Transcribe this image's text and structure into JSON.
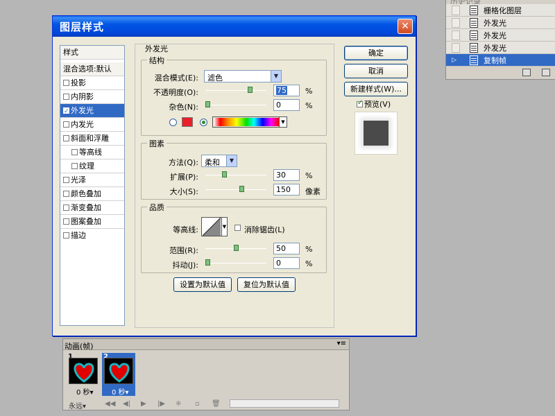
{
  "history": {
    "title": "历史记录",
    "items": [
      {
        "label": "栅格化图层",
        "selected": false
      },
      {
        "label": "外发光",
        "selected": false
      },
      {
        "label": "外发光",
        "selected": false
      },
      {
        "label": "外发光",
        "selected": false
      },
      {
        "label": "复制帧",
        "selected": true
      }
    ]
  },
  "dialog": {
    "title": "图层样式",
    "close_icon": "✕",
    "styles_list": {
      "header": "样式",
      "blend_options": "混合选项:默认",
      "items": [
        {
          "label": "投影",
          "checked": false,
          "indent": false,
          "selected": false
        },
        {
          "label": "内阴影",
          "checked": false,
          "indent": false,
          "selected": false
        },
        {
          "label": "外发光",
          "checked": true,
          "indent": false,
          "selected": true
        },
        {
          "label": "内发光",
          "checked": false,
          "indent": false,
          "selected": false
        },
        {
          "label": "斜面和浮雕",
          "checked": false,
          "indent": false,
          "selected": false
        },
        {
          "label": "等高线",
          "checked": false,
          "indent": true,
          "selected": false
        },
        {
          "label": "纹理",
          "checked": false,
          "indent": true,
          "selected": false
        },
        {
          "label": "光泽",
          "checked": false,
          "indent": false,
          "selected": false
        },
        {
          "label": "颜色叠加",
          "checked": false,
          "indent": false,
          "selected": false
        },
        {
          "label": "渐变叠加",
          "checked": false,
          "indent": false,
          "selected": false
        },
        {
          "label": "图案叠加",
          "checked": false,
          "indent": false,
          "selected": false
        },
        {
          "label": "描边",
          "checked": false,
          "indent": false,
          "selected": false
        }
      ]
    },
    "section_title": "外发光",
    "structure": {
      "caption": "结构",
      "blend_mode_label": "混合模式(E):",
      "blend_mode_value": "滤色",
      "opacity_label": "不透明度(O):",
      "opacity_value": "75",
      "opacity_fraction": 0.75,
      "noise_label": "杂色(N):",
      "noise_value": "0",
      "noise_fraction": 0.0,
      "percent": "%",
      "color_swatch": "#e8202a"
    },
    "elements": {
      "caption": "图素",
      "technique_label": "方法(Q):",
      "technique_value": "柔和",
      "spread_label": "扩展(P):",
      "spread_value": "30",
      "spread_fraction": 0.3,
      "size_label": "大小(S):",
      "size_value": "150",
      "size_fraction": 0.6,
      "size_unit": "像素",
      "percent": "%"
    },
    "quality": {
      "caption": "品质",
      "contour_label": "等高线:",
      "antialias_label": "消除锯齿(L)",
      "range_label": "范围(R):",
      "range_value": "50",
      "range_fraction": 0.5,
      "jitter_label": "抖动(J):",
      "jitter_value": "0",
      "jitter_fraction": 0.0,
      "percent": "%"
    },
    "make_default": "设置为默认值",
    "reset_default": "复位为默认值",
    "buttons": {
      "ok": "确定",
      "cancel": "取消",
      "new_style": "新建样式(W)...",
      "preview": "预览(V)"
    }
  },
  "animation": {
    "tab": "动画(帧)",
    "menu_icon": "▾≡",
    "frames": [
      {
        "number": "1",
        "delay": "0 秒▾",
        "selected": false
      },
      {
        "number": "2",
        "delay": "0 秒▾",
        "selected": true
      }
    ],
    "loop": "永远▾",
    "controls": [
      "◀◀",
      "◀|",
      "▶",
      "|▶",
      "⁜",
      "▫",
      "🗑"
    ]
  }
}
